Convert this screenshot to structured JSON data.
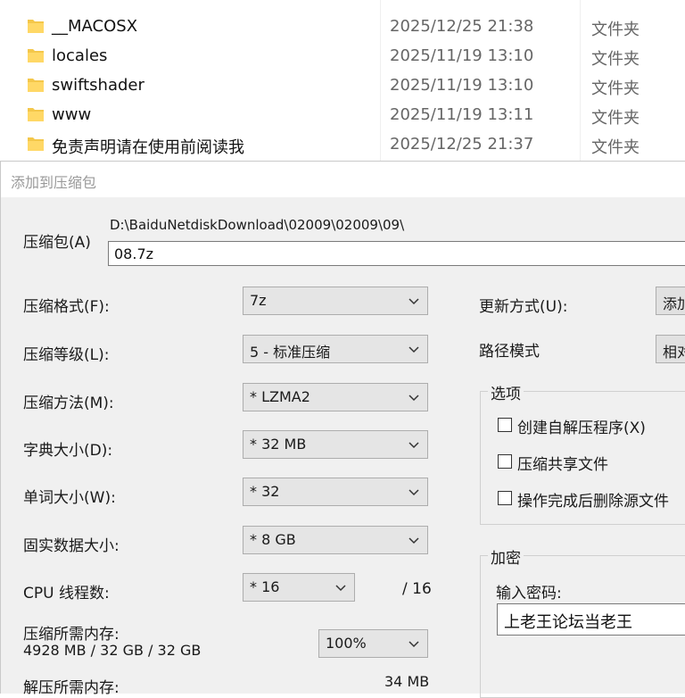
{
  "files": [
    {
      "name": "__MACOSX",
      "date": "2025/12/25 21:38",
      "type": "文件夹"
    },
    {
      "name": "locales",
      "date": "2025/11/19 13:10",
      "type": "文件夹"
    },
    {
      "name": "swiftshader",
      "date": "2025/11/19 13:10",
      "type": "文件夹"
    },
    {
      "name": "www",
      "date": "2025/11/19 13:11",
      "type": "文件夹"
    },
    {
      "name": "免责声明请在使用前阅读我",
      "date": "2025/12/25 21:37",
      "type": "文件夹"
    }
  ],
  "dialog": {
    "title": "添加到压缩包",
    "archive_label": "压缩包(A)",
    "archive_path": "D:\\BaiduNetdiskDownload\\02009\\02009\\09\\",
    "archive_name": "08.7z",
    "format_label": "压缩格式(F):",
    "format_value": "7z",
    "level_label": "压缩等级(L):",
    "level_value": "5 - 标准压缩",
    "method_label": "压缩方法(M):",
    "method_value": "* LZMA2",
    "dict_label": "字典大小(D):",
    "dict_value": "* 32 MB",
    "word_label": "单词大小(W):",
    "word_value": "* 32",
    "solid_label": "固实数据大小:",
    "solid_value": "* 8 GB",
    "threads_label": "CPU 线程数:",
    "threads_value": "* 16",
    "threads_max": "/ 16",
    "comp_mem_label": "压缩所需内存:",
    "comp_mem_value": "4928 MB / 32 GB / 32 GB",
    "mem_percent": "100%",
    "decomp_mem_label": "解压所需内存:",
    "decomp_mem_value": "34 MB",
    "update_label": "更新方式(U):",
    "update_value": "添加",
    "path_mode_label": "路径模式",
    "path_mode_value": "相对",
    "options_title": "选项",
    "opt_sfx": "创建自解压程序(X)",
    "opt_shared": "压缩共享文件",
    "opt_delete": "操作完成后删除源文件",
    "encrypt_title": "加密",
    "password_label": "输入密码:",
    "password_value": "上老王论坛当老王"
  }
}
